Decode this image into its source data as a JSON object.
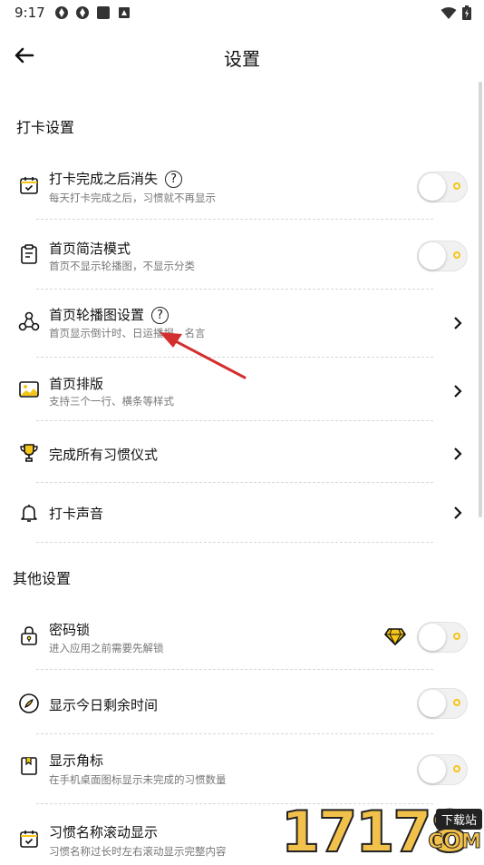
{
  "status_bar": {
    "time": "9:17"
  },
  "header": {
    "title": "设置"
  },
  "sections": {
    "checkin": {
      "title": "打卡设置"
    },
    "other": {
      "title": "其他设置"
    }
  },
  "rows": {
    "vanish": {
      "label": "打卡完成之后消失",
      "help": "?",
      "sub": "每天打卡完成之后，习惯就不再显示"
    },
    "simple": {
      "label": "首页简洁模式",
      "sub": "首页不显示轮播图，不显示分类"
    },
    "carousel": {
      "label": "首页轮播图设置",
      "help": "?",
      "sub": "首页显示倒计时、日运播报、名言"
    },
    "layout": {
      "label": "首页排版",
      "sub": "支持三个一行、横条等样式"
    },
    "ritual": {
      "label": "完成所有习惯仪式"
    },
    "sound": {
      "label": "打卡声音"
    },
    "lock": {
      "label": "密码锁",
      "sub": "进入应用之前需要先解锁"
    },
    "remaining": {
      "label": "显示今日剩余时间"
    },
    "badge": {
      "label": "显示角标",
      "sub": "在手机桌面图标显示未完成的习惯数量"
    },
    "scroll": {
      "label": "习惯名称滚动显示",
      "sub": "习惯名称过长时左右滚动显示完整内容"
    }
  },
  "watermark": {
    "digits": "17178",
    "badge": "下载站",
    "domain": "COM"
  },
  "colors": {
    "accent": "#f5c518",
    "arrow": "#d32f2f",
    "text": "#111111",
    "subtext": "#777777"
  }
}
